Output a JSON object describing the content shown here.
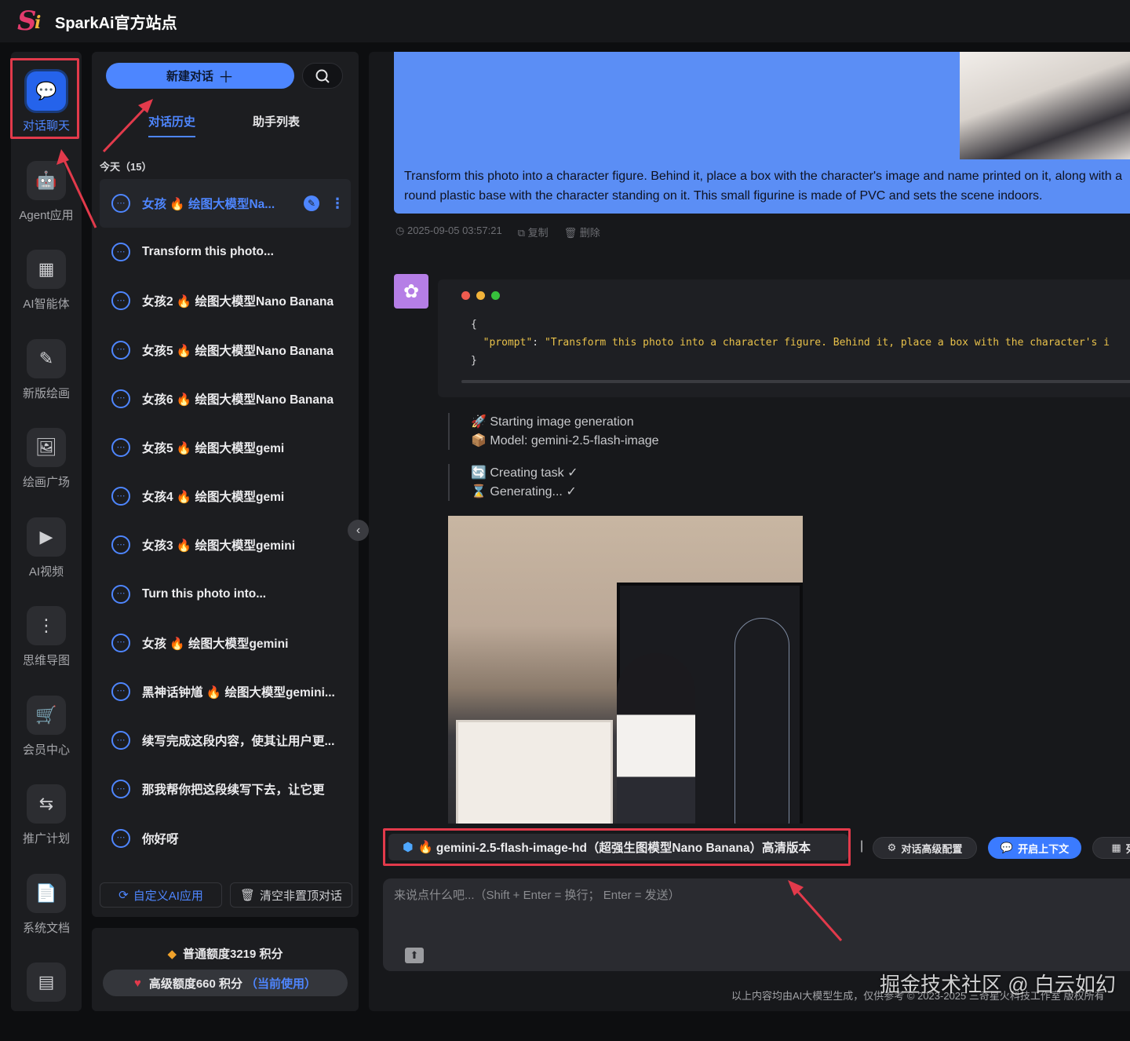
{
  "app": {
    "title": "SparkAi官方站点"
  },
  "rail": {
    "items": [
      {
        "label": "对话聊天",
        "icon": "chat-bubble-icon",
        "active": true
      },
      {
        "label": "Agent应用",
        "icon": "robot-icon"
      },
      {
        "label": "AI智能体",
        "icon": "grid-icon"
      },
      {
        "label": "新版绘画",
        "icon": "paint-icon"
      },
      {
        "label": "绘画广场",
        "icon": "image-icon"
      },
      {
        "label": "AI视频",
        "icon": "video-icon"
      },
      {
        "label": "思维导图",
        "icon": "mindmap-icon"
      },
      {
        "label": "会员中心",
        "icon": "cart-icon"
      },
      {
        "label": "推广计划",
        "icon": "share-icon"
      },
      {
        "label": "系统文档",
        "icon": "doc-icon"
      },
      {
        "label": "",
        "icon": "archive-icon"
      }
    ]
  },
  "history": {
    "new_chat": "新建对话",
    "tabs": [
      "对话历史",
      "助手列表"
    ],
    "section": "今天（15）",
    "items": [
      {
        "pre": "女孩",
        "post": "绘图大模型Na...",
        "flame": true
      },
      {
        "pre": "Transform this photo...",
        "post": "",
        "flame": false
      },
      {
        "pre": "女孩2",
        "post": "绘图大模型Nano Banana",
        "flame": true
      },
      {
        "pre": "女孩5",
        "post": "绘图大模型Nano Banana",
        "flame": true
      },
      {
        "pre": "女孩6",
        "post": "绘图大模型Nano Banana",
        "flame": true
      },
      {
        "pre": "女孩5",
        "post": "绘图大模型gemi",
        "flame": true
      },
      {
        "pre": "女孩4",
        "post": "绘图大模型gemi",
        "flame": true
      },
      {
        "pre": "女孩3",
        "post": "绘图大模型gemini",
        "flame": true
      },
      {
        "pre": "Turn this photo into...",
        "post": "",
        "flame": false
      },
      {
        "pre": "女孩",
        "post": "绘图大模型gemini",
        "flame": true
      },
      {
        "pre": "黑神话钟馗",
        "post": "绘图大模型gemini...",
        "flame": true
      },
      {
        "pre": "续写完成这段内容，使其让用户更...",
        "post": "",
        "flame": false
      },
      {
        "pre": "那我帮你把这段续写下去，让它更",
        "post": "",
        "flame": false
      },
      {
        "pre": "你好呀",
        "post": "",
        "flame": false
      }
    ],
    "custom_app": "自定义AI应用",
    "clear": "清空非置顶对话"
  },
  "quota": {
    "normal": "普通额度3219 积分",
    "premium": "高级额度660 积分",
    "current": "（当前使用）"
  },
  "chat": {
    "user_text_1": "Transform this photo into a character figure. Behind it, place a box with the character's image and name printed on it, along with a",
    "user_text_2": "round plastic base with the character standing on it. This small figurine is made of PVC and sets the scene indoors.",
    "timestamp": "2025-09-05 03:57:21",
    "copy": "复制",
    "delete": "删除",
    "code_open": "{",
    "code_key": "\"prompt\"",
    "code_colon": ": ",
    "code_value": "\"Transform this photo into a character figure. Behind it, place a box with the character's i",
    "code_close": "}",
    "log1": [
      "Starting image generation",
      "Model: gemini-2.5-flash-image"
    ],
    "log2": [
      "Creating task ✓",
      "Generating... ✓"
    ]
  },
  "model_bar": {
    "model": "gemini-2.5-flash-image-hd（超强生图模型Nano Banana）高清版本",
    "config": "对话高级配置",
    "context": "开启上下文",
    "more": "列"
  },
  "input": {
    "placeholder": "来说点什么吧...（Shift + Enter = 换行； Enter = 发送）"
  },
  "footer": "以上内容均由AI大模型生成，仅供参考 © 2023-2025 三奇星火科技工作室 版权所有",
  "watermark": "掘金技术社区 @ 白云如幻",
  "colors": {
    "accent": "#4e86ff",
    "highlight": "#e23a4b",
    "user_bubble": "#5b8ef5"
  }
}
